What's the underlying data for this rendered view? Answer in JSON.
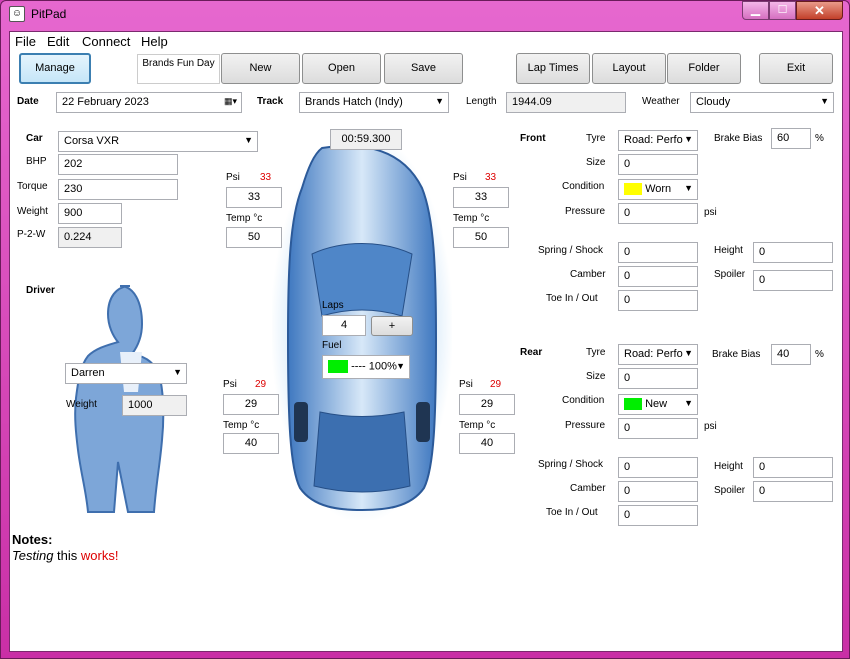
{
  "window": {
    "title": "PitPad"
  },
  "menu": [
    "File",
    "Edit",
    "Connect",
    "Help"
  ],
  "toolbar": {
    "manage": "Manage",
    "session": "Brands Fun Day",
    "new": "New",
    "open": "Open",
    "save": "Save",
    "lap_times": "Lap Times",
    "layout": "Layout",
    "folder": "Folder",
    "exit": "Exit"
  },
  "header": {
    "date_label": "Date",
    "date": "22  February  2023",
    "track_label": "Track",
    "track": "Brands Hatch (Indy)",
    "length_label": "Length",
    "length": "1944.09",
    "weather_label": "Weather",
    "weather": "Cloudy"
  },
  "car": {
    "car_label": "Car",
    "car": "Corsa VXR",
    "bhp_label": "BHP",
    "bhp": "202",
    "torque_label": "Torque",
    "torque": "230",
    "weight_label": "Weight",
    "weight": "900",
    "p2w_label": "P-2-W",
    "p2w": "0.224"
  },
  "driver": {
    "label": "Driver",
    "name": "Darren",
    "weight_label": "Weight",
    "weight": "1000"
  },
  "timer": "00:59.300",
  "tyres": {
    "fl": {
      "psi_label": "Psi",
      "psi_target": "33",
      "psi": "33",
      "temp_label": "Temp °c",
      "temp": "50"
    },
    "fr": {
      "psi_label": "Psi",
      "psi_target": "33",
      "psi": "33",
      "temp_label": "Temp °c",
      "temp": "50"
    },
    "rl": {
      "psi_label": "Psi",
      "psi_target": "29",
      "psi": "29",
      "temp_label": "Temp °c",
      "temp": "40"
    },
    "rr": {
      "psi_label": "Psi",
      "psi_target": "29",
      "psi": "29",
      "temp_label": "Temp °c",
      "temp": "40"
    }
  },
  "laps": {
    "label": "Laps",
    "value": "4",
    "inc": "+"
  },
  "fuel": {
    "label": "Fuel",
    "value": "---- 100%",
    "color": "#00ee00"
  },
  "front": {
    "label": "Front",
    "tyre_label": "Tyre",
    "tyre": "Road: Perfo",
    "size_label": "Size",
    "size": "0",
    "condition_label": "Condition",
    "condition": "Worn",
    "condition_color": "#ffff00",
    "pressure_label": "Pressure",
    "pressure": "0",
    "psi_unit": "psi",
    "brake_bias_label": "Brake Bias",
    "brake_bias": "60",
    "pct": "%",
    "spring_label": "Spring / Shock",
    "spring": "0",
    "camber_label": "Camber",
    "camber": "0",
    "toe_label": "Toe In / Out",
    "toe": "0",
    "height_label": "Height",
    "height": "0",
    "spoiler_label": "Spoiler",
    "spoiler": "0"
  },
  "rear": {
    "label": "Rear",
    "tyre_label": "Tyre",
    "tyre": "Road: Perfo",
    "size_label": "Size",
    "size": "0",
    "condition_label": "Condition",
    "condition": "New",
    "condition_color": "#00ee00",
    "pressure_label": "Pressure",
    "pressure": "0",
    "psi_unit": "psi",
    "brake_bias_label": "Brake Bias",
    "brake_bias": "40",
    "pct": "%",
    "spring_label": "Spring / Shock",
    "spring": "0",
    "camber_label": "Camber",
    "camber": "0",
    "toe_label": "Toe In / Out",
    "toe": "0",
    "height_label": "Height",
    "height": "0",
    "spoiler_label": "Spoiler",
    "spoiler": "0"
  },
  "notes": {
    "label": "Notes:",
    "word1": "Testing",
    "word2": " this ",
    "word3": "works!"
  }
}
